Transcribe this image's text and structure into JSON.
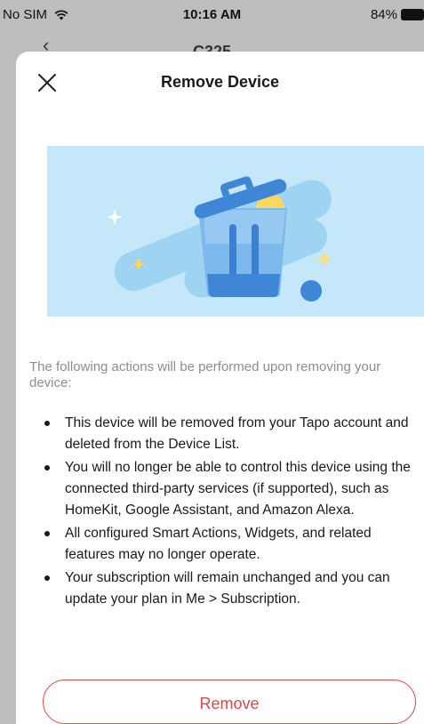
{
  "status_bar": {
    "carrier": "No SIM",
    "time": "10:16 AM",
    "battery": "84%"
  },
  "behind": {
    "title": "C325"
  },
  "sheet": {
    "title": "Remove Device",
    "intro": "The following actions will be performed upon removing your device:",
    "bullets": [
      "This device will be removed from your Tapo account and deleted from the Device List.",
      "You will no longer be able to control this device using the connected third-party services (if supported), such as HomeKit, Google Assistant, and Amazon Alexa.",
      "All configured Smart Actions, Widgets, and related features may no longer operate.",
      "Your subscription will remain unchanged and you can update your plan in Me > Subscription."
    ],
    "remove_label": "Remove"
  },
  "icons": {
    "close": "close-icon",
    "wifi": "wifi-icon",
    "battery": "battery-icon",
    "back": "back-chevron-icon",
    "illustration": "trash-can-icon"
  },
  "colors": {
    "accent_red": "#e04848",
    "illustration_bg": "#bfe4f8",
    "trash_blue": "#3f87d6"
  }
}
